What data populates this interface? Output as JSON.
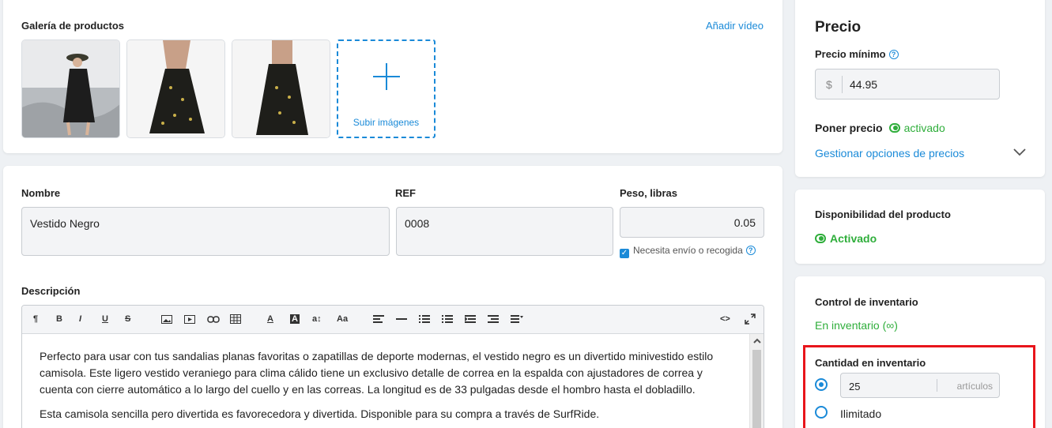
{
  "gallery": {
    "title": "Galería de productos",
    "add_video": "Añadir vídeo",
    "upload_label": "Subir imágenes",
    "thumbnails": [
      "product-photo-beach",
      "product-photo-front",
      "product-photo-back"
    ]
  },
  "product": {
    "name_label": "Nombre",
    "name_value": "Vestido Negro",
    "ref_label": "REF",
    "ref_value": "0008",
    "weight_label": "Peso, libras",
    "weight_value": "0.05",
    "shipping_label": "Necesita envío o recogida",
    "description_label": "Descripción",
    "description_p1": "Perfecto para usar con tus sandalias planas favoritas o zapatillas de deporte modernas, el vestido negro es un divertido minivestido estilo camisola. Este ligero vestido veraniego para clima cálido tiene un exclusivo detalle de correa en la espalda con ajustadores de correa y cuenta con cierre automático a lo largo del cuello y en las correas. La longitud es de 33 pulgadas desde el hombro hasta el dobladillo.",
    "description_p2": "Esta camisola sencilla pero divertida es favorecedora y divertida. Disponible para su compra a través de SurfRide."
  },
  "toolbar": {
    "paragraph": "¶",
    "bold": "B",
    "italic": "I",
    "underline": "U",
    "strike": "S",
    "text_color": "A",
    "bg_color": "A",
    "font_size": "a↕",
    "font_case": "Aa",
    "code": "<>"
  },
  "price": {
    "title": "Precio",
    "min_label": "Precio mínimo",
    "currency": "$",
    "min_value": "44.95",
    "set_price_label": "Poner precio",
    "set_price_status": "activado",
    "manage_link": "Gestionar opciones de precios"
  },
  "availability": {
    "title": "Disponibilidad del producto",
    "status": "Activado"
  },
  "inventory": {
    "title": "Control de inventario",
    "status": "En inventario (∞)",
    "qty_title": "Cantidad en inventario",
    "qty_value": "25",
    "qty_unit": "artículos",
    "unlimited": "Ilimitado"
  },
  "colors": {
    "accent": "#1a8ad8",
    "success": "#2fae3b",
    "highlight": "#e8151b"
  }
}
